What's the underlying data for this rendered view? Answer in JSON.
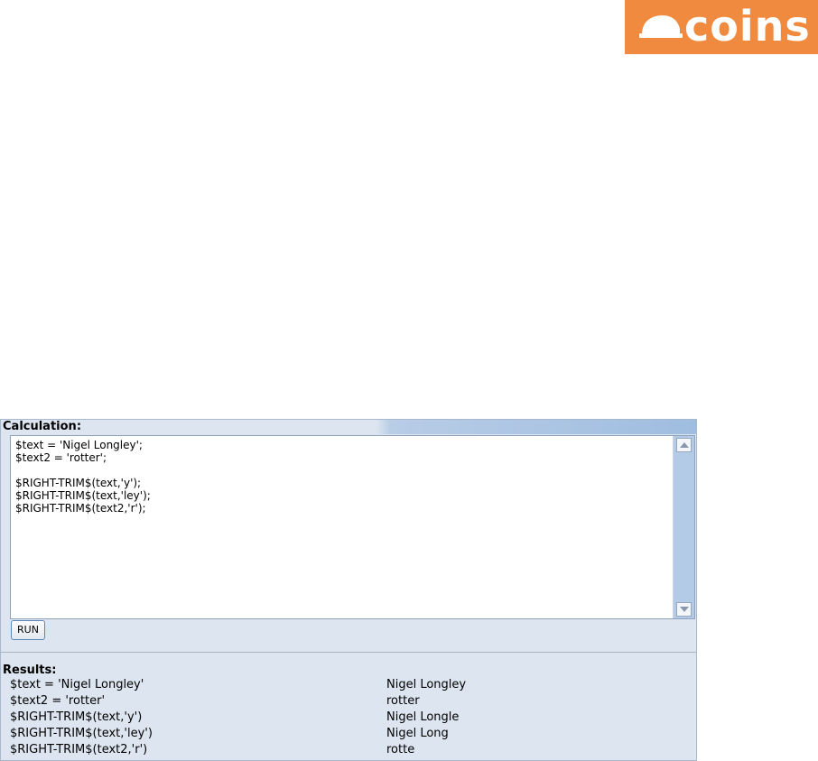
{
  "logo": {
    "text": "coins",
    "color": "#f08a3e"
  },
  "calculation": {
    "header": "Calculation:",
    "code": "$text = 'Nigel Longley';\n$text2 = 'rotter';\n\n$RIGHT-TRIM$(text,'y');\n$RIGHT-TRIM$(text,'ley');\n$RIGHT-TRIM$(text2,'r');",
    "run_label": "RUN"
  },
  "results": {
    "title": "Results:",
    "rows": [
      {
        "expr": "$text = 'Nigel Longley'",
        "value": "Nigel Longley"
      },
      {
        "expr": "$text2 = 'rotter'",
        "value": "rotter"
      },
      {
        "expr": "$RIGHT-TRIM$(text,'y')",
        "value": "Nigel Longle"
      },
      {
        "expr": "$RIGHT-TRIM$(text,'ley')",
        "value": "Nigel Long"
      },
      {
        "expr": "$RIGHT-TRIM$(text2,'r')",
        "value": "rotte"
      }
    ]
  }
}
